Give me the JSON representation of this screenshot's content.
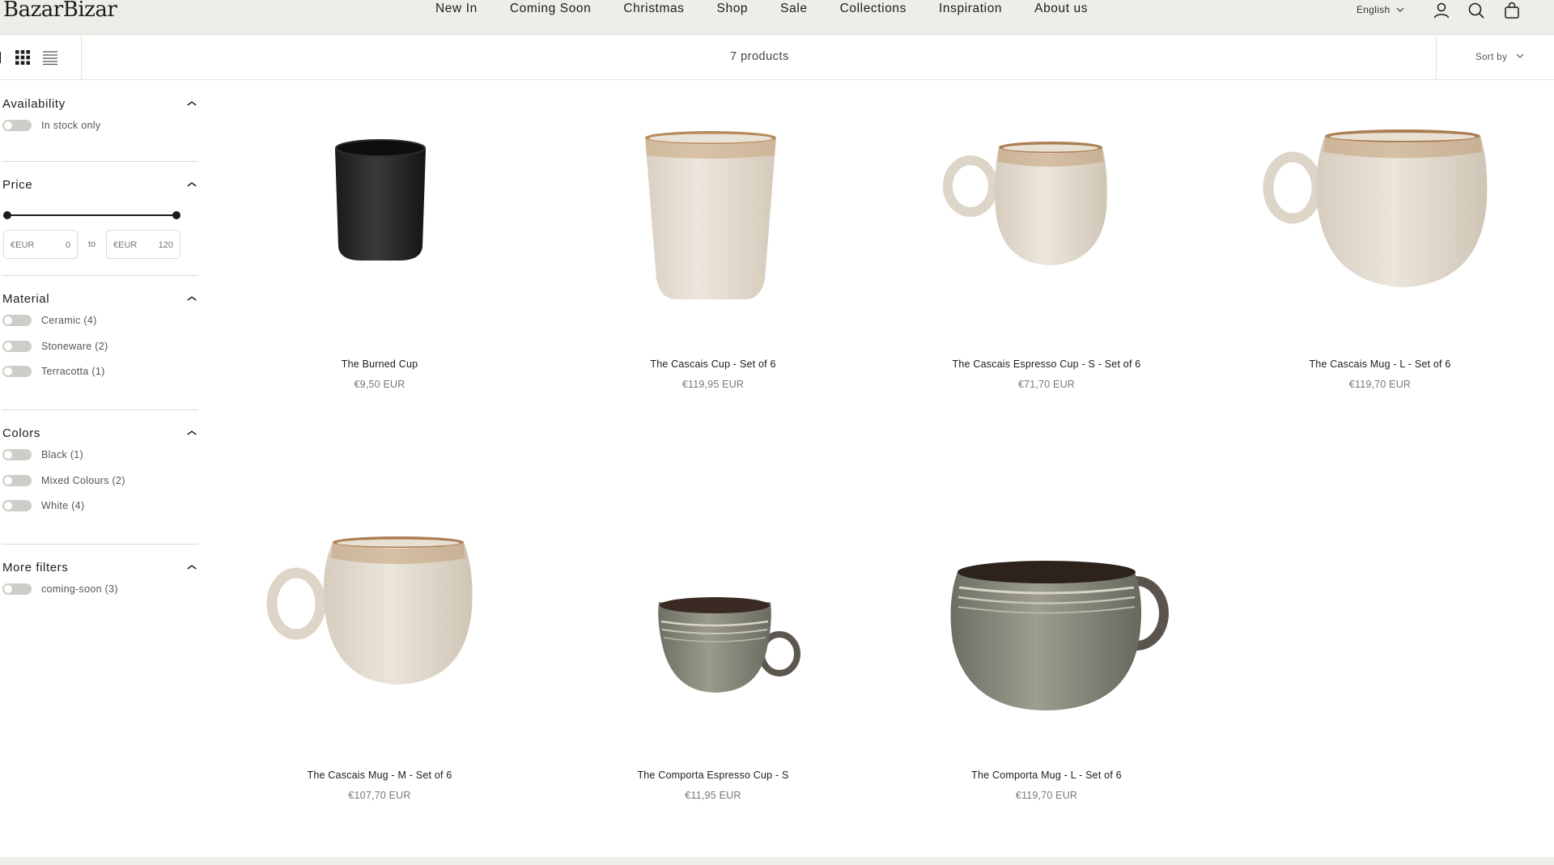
{
  "header": {
    "logo": "BazarBizar",
    "nav": [
      "New In",
      "Coming Soon",
      "Christmas",
      "Shop",
      "Sale",
      "Collections",
      "Inspiration",
      "About us"
    ],
    "language": "English",
    "icons": [
      "account-icon",
      "search-icon",
      "cart-icon"
    ]
  },
  "toolbar": {
    "product_count": "7 products",
    "sort_label": "Sort by",
    "views": [
      "list-view-icon",
      "grid-view-icon",
      "compact-list-icon"
    ]
  },
  "filters": {
    "availability": {
      "title": "Availability",
      "options": [
        "In stock only"
      ]
    },
    "price": {
      "title": "Price",
      "currency": "€EUR",
      "min": "0",
      "max": "120",
      "to_label": "to"
    },
    "material": {
      "title": "Material",
      "options": [
        "Ceramic (4)",
        "Stoneware (2)",
        "Terracotta (1)"
      ]
    },
    "colors": {
      "title": "Colors",
      "options": [
        "Black (1)",
        "Mixed Colours (2)",
        "White (4)"
      ]
    },
    "more": {
      "title": "More filters",
      "options": [
        "coming-soon (3)"
      ]
    }
  },
  "products": [
    {
      "name": "The Burned Cup",
      "price": "€9,50 EUR"
    },
    {
      "name": "The Cascais Cup - Set of 6",
      "price": "€119,95 EUR"
    },
    {
      "name": "The Cascais Espresso Cup - S - Set of 6",
      "price": "€71,70 EUR"
    },
    {
      "name": "The Cascais Mug - L - Set of 6",
      "price": "€119,70 EUR"
    },
    {
      "name": "The Cascais Mug - M - Set of 6",
      "price": "€107,70 EUR"
    },
    {
      "name": "The Comporta Espresso Cup - S",
      "price": "€11,95 EUR"
    },
    {
      "name": "The Comporta Mug - L - Set of 6",
      "price": "€119,70 EUR"
    }
  ],
  "colors": {
    "header_bg": "#efede8",
    "text": "#1c1c1c",
    "muted": "#777777",
    "toggle": "#cfcdc8"
  }
}
